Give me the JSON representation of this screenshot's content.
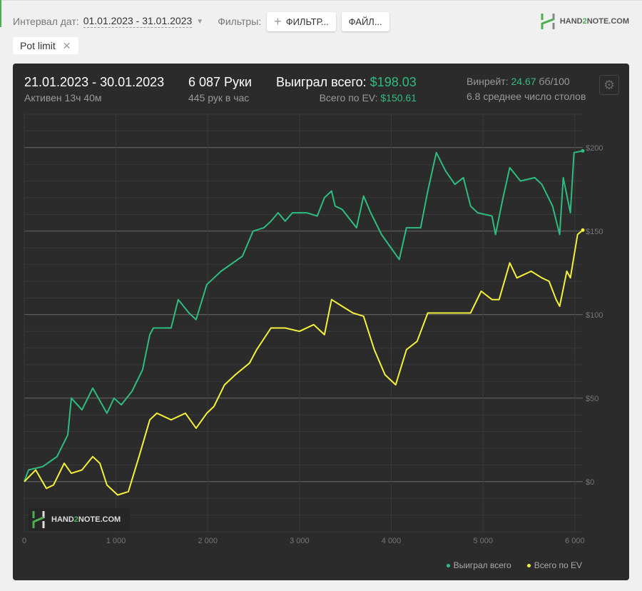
{
  "toolbar": {
    "date_interval_label": "Интервал дат:",
    "date_interval_value": "01.01.2023 - 31.01.2023",
    "filters_label": "Фильтры:",
    "filter_button": "ФИЛЬТР...",
    "file_button": "ФАЙЛ..."
  },
  "logo": {
    "text_a": "HAND",
    "text_b": "2",
    "text_c": "NOTE.COM"
  },
  "active_filter": {
    "label": "Pot limit"
  },
  "stats": {
    "period": "21.01.2023 - 30.01.2023",
    "active": "Активен 13ч 40м",
    "hands": "6 087 Руки",
    "hands_per_hour": "445 рук в час",
    "won_label": "Выиграл всего:",
    "won_value": "$198.03",
    "ev_label": "Всего по EV:",
    "ev_value": "$150.61",
    "winrate_label": "Винрейт:",
    "winrate_value": "24.67",
    "winrate_unit": "бб/100",
    "tables": "6.8 среднее число столов"
  },
  "colors": {
    "won": "#2ebd7f",
    "ev": "#f5f03c",
    "accent": "#4caf50"
  },
  "chart_data": {
    "type": "line",
    "xlabel": "",
    "ylabel": "",
    "xlim": [
      0,
      6087
    ],
    "ylim": [
      -30,
      220
    ],
    "x_ticks": [
      0,
      1000,
      2000,
      3000,
      4000,
      5000,
      6000
    ],
    "x_tick_labels": [
      "0",
      "1 000",
      "2 000",
      "3 000",
      "4 000",
      "5 000",
      "6 000"
    ],
    "y_ticks": [
      0,
      50,
      100,
      150,
      200
    ],
    "y_tick_labels": [
      "$0",
      "$50",
      "$100",
      "$150",
      "$200"
    ],
    "grid": true,
    "legend_position": "bottom-right",
    "series": [
      {
        "name": "Выиграл всего",
        "color": "#2ebd7f",
        "x": [
          0,
          47,
          202,
          357,
          474,
          513,
          629,
          746,
          901,
          979,
          1057,
          1173,
          1290,
          1368,
          1407,
          1601,
          1678,
          1795,
          1873,
          1989,
          2145,
          2378,
          2494,
          2611,
          2689,
          2766,
          2844,
          2922,
          3077,
          3193,
          3271,
          3349,
          3388,
          3465,
          3621,
          3698,
          3776,
          3893,
          4009,
          4087,
          4165,
          4320,
          4398,
          4491,
          4592,
          4693,
          4786,
          4864,
          4941,
          5097,
          5136,
          5214,
          5291,
          5408,
          5563,
          5641,
          5757,
          5835,
          5874,
          5952,
          5991,
          6087
        ],
        "y": [
          0,
          7,
          9,
          15,
          28,
          50,
          43,
          56,
          41,
          50,
          46,
          54,
          67,
          88,
          92,
          92,
          109,
          101,
          97,
          118,
          126,
          135,
          150,
          152,
          156,
          161,
          156,
          161,
          161,
          159,
          170,
          174,
          165,
          163,
          152,
          171,
          161,
          148,
          139,
          133,
          152,
          152,
          174,
          197,
          186,
          178,
          182,
          165,
          161,
          159,
          148,
          169,
          188,
          180,
          182,
          178,
          165,
          148,
          182,
          161,
          197,
          198.03
        ]
      },
      {
        "name": "Всего по EV",
        "color": "#f5f03c",
        "x": [
          0,
          124,
          241,
          319,
          435,
          513,
          629,
          746,
          824,
          901,
          1018,
          1134,
          1251,
          1368,
          1445,
          1601,
          1756,
          1873,
          1989,
          2067,
          2183,
          2300,
          2455,
          2533,
          2689,
          2844,
          2999,
          3155,
          3271,
          3349,
          3465,
          3582,
          3698,
          3815,
          3931,
          4048,
          4165,
          4281,
          4398,
          4553,
          4708,
          4864,
          4980,
          5097,
          5175,
          5291,
          5369,
          5524,
          5641,
          5719,
          5796,
          5835,
          5913,
          5952,
          6030,
          6087
        ],
        "y": [
          0,
          7,
          -4,
          -2,
          11,
          5,
          7,
          15,
          11,
          -2,
          -8,
          -6,
          15,
          37,
          41,
          37,
          41,
          32,
          41,
          45,
          58,
          64,
          71,
          79,
          92,
          92,
          90,
          94,
          88,
          109,
          105,
          101,
          99,
          79,
          64,
          58,
          79,
          84,
          101,
          101,
          101,
          101,
          114,
          109,
          109,
          131,
          122,
          126,
          122,
          120,
          109,
          105,
          126,
          122,
          148,
          150.61
        ]
      }
    ]
  }
}
